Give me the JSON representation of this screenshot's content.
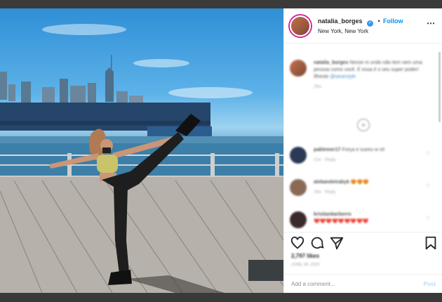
{
  "post": {
    "username": "natalia_borges",
    "follow_label": "Follow",
    "separator": "•",
    "location": "New York, New York"
  },
  "caption": {
    "username": "natalia_borges",
    "text": "Nesse m undo não tem nem uma pessoa como você. E essa é o seu super poder!",
    "more": "Ilfrente",
    "tag": "@wearstyle",
    "time": "26w"
  },
  "comments": [
    {
      "user": "paklemer17",
      "text": "Força e sueeu w st!",
      "time": "21w",
      "reply": "Reply"
    },
    {
      "user": "alebandeirabyk",
      "text": "😍😍😍",
      "time": "26w",
      "reply": "Reply"
    },
    {
      "user": "kristianbarberro",
      "text": "❤️❤️❤️❤️❤️❤️❤️❤️❤️",
      "time": "",
      "reply": ""
    }
  ],
  "likes": "2,797 likes",
  "date": "JUNE 28, 2020",
  "add_comment_placeholder": "Add a comment...",
  "post_button": "Post",
  "icons": [
    "heart-icon",
    "comment-icon",
    "share-icon",
    "bookmark-icon",
    "verified-icon",
    "more-icon"
  ]
}
